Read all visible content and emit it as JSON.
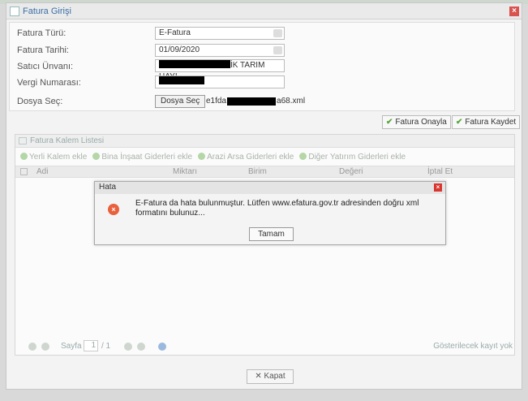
{
  "window": {
    "title": "Fatura Girişi",
    "close": "×"
  },
  "form": {
    "fatura_turu_label": "Fatura Türü:",
    "fatura_turu_value": "E-Fatura",
    "fatura_tarihi_label": "Fatura Tarihi:",
    "fatura_tarihi_value": "01/09/2020",
    "satici_label": "Satıcı Ünvanı:",
    "satici_value": "İK TARIM HAY!",
    "vergi_label": "Vergi Numarası:",
    "dosya_label": "Dosya Seç:",
    "dosya_button": "Dosya Seç",
    "dosya_name_prefix": "e1fda",
    "dosya_name_suffix": "a68.xml"
  },
  "actions": {
    "onayla": "Fatura Onayla",
    "kaydet": "Fatura Kaydet"
  },
  "list": {
    "title": "Fatura Kalem Listesi",
    "toolbar": [
      "Yerli Kalem ekle",
      "Bina İnşaat Giderleri ekle",
      "Arazi Arsa Giderleri ekle",
      "Diğer Yatırım Giderleri ekle"
    ],
    "columns": [
      "Adi",
      "Miktarı",
      "Birim",
      "Değeri",
      "İptal Et"
    ],
    "pager": {
      "page_label": "Sayfa",
      "page": "1",
      "of": "/ 1",
      "empty": "Gösterilecek kayıt yok"
    }
  },
  "kapat": "✕ Kapat",
  "dialog": {
    "title": "Hata",
    "message": "E-Fatura da hata bulunmuştur. Lütfen www.efatura.gov.tr adresinden doğru xml formatını bulunuz...",
    "ok": "Tamam"
  }
}
